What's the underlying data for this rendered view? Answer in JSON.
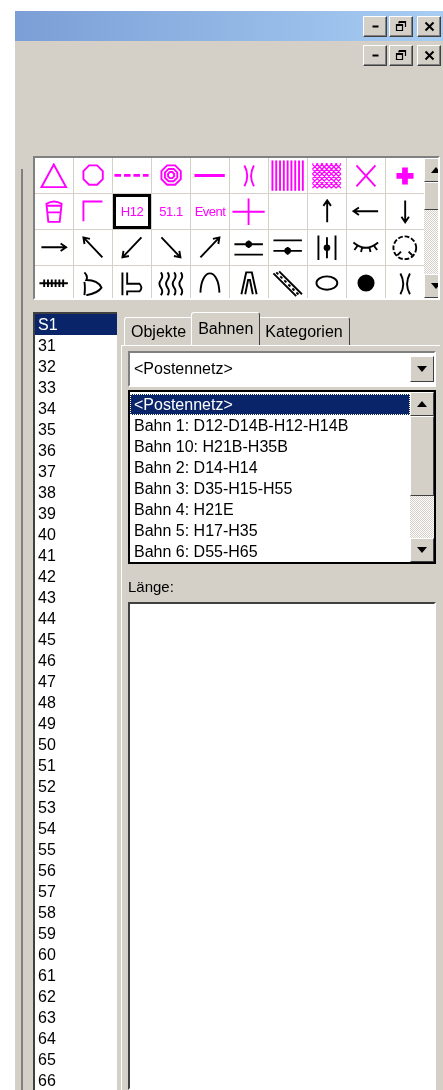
{
  "title_bar": {
    "buttons": [
      {
        "kind": "minimize"
      },
      {
        "kind": "restore"
      },
      {
        "kind": "close"
      }
    ]
  },
  "child_window": {
    "buttons": [
      {
        "kind": "minimize"
      },
      {
        "kind": "restore"
      },
      {
        "kind": "close"
      }
    ]
  },
  "palette": {
    "cells": [
      {
        "kind": "triangle",
        "color": "#ff00ff",
        "selected": false
      },
      {
        "kind": "octagon",
        "color": "#ff00ff",
        "selected": false
      },
      {
        "kind": "dashed-line",
        "color": "#ff00ff",
        "selected": false
      },
      {
        "kind": "concentric",
        "color": "#ff00ff",
        "selected": false
      },
      {
        "kind": "thick-line",
        "color": "#ff00ff",
        "selected": false
      },
      {
        "kind": "bracket",
        "color": "#ff00ff",
        "selected": false
      },
      {
        "kind": "vertical-hatch",
        "color": "#ff00ff",
        "selected": false
      },
      {
        "kind": "crosshatch",
        "color": "#ff00ff",
        "selected": false
      },
      {
        "kind": "x-mark",
        "color": "#ff00ff",
        "selected": false
      },
      {
        "kind": "plus",
        "color": "#ff00ff",
        "selected": false
      },
      {
        "kind": "cup",
        "color": "#ff00ff",
        "selected": false
      },
      {
        "kind": "corner",
        "color": "#ff00ff",
        "selected": false
      },
      {
        "kind": "text",
        "text": "H12",
        "color": "#ff00ff",
        "selected": true
      },
      {
        "kind": "text",
        "text": "51.1",
        "color": "#ff00ff",
        "selected": false
      },
      {
        "kind": "text",
        "text": "Event",
        "color": "#ff00ff",
        "selected": false
      },
      {
        "kind": "plus-line",
        "color": "#ff00ff",
        "selected": false
      },
      {
        "kind": "empty",
        "selected": false
      },
      {
        "kind": "arrow-up",
        "color": "#000000",
        "selected": false
      },
      {
        "kind": "arrow-left",
        "color": "#000000",
        "selected": false
      },
      {
        "kind": "arrow-down",
        "color": "#000000",
        "selected": false
      },
      {
        "kind": "arrow-right",
        "color": "#000000",
        "selected": false
      },
      {
        "kind": "arrow-up-left",
        "color": "#000000",
        "selected": false
      },
      {
        "kind": "arrow-down-left",
        "color": "#000000",
        "selected": false
      },
      {
        "kind": "arrow-down-right",
        "color": "#000000",
        "selected": false
      },
      {
        "kind": "arrow-up-right",
        "color": "#000000",
        "selected": false
      },
      {
        "kind": "lines-dot-top",
        "color": "#000000",
        "selected": false
      },
      {
        "kind": "lines-dot-bottom",
        "color": "#000000",
        "selected": false
      },
      {
        "kind": "vertical-lines-dot",
        "color": "#000000",
        "selected": false
      },
      {
        "kind": "eyelash",
        "color": "#000000",
        "selected": false
      },
      {
        "kind": "gauge",
        "color": "#000000",
        "selected": false
      },
      {
        "kind": "tick-line",
        "color": "#000000",
        "selected": false
      },
      {
        "kind": "curve",
        "color": "#000000",
        "selected": false
      },
      {
        "kind": "step-curve",
        "color": "#000000",
        "selected": false
      },
      {
        "kind": "wavy-lines",
        "color": "#000000",
        "selected": false
      },
      {
        "kind": "arch",
        "color": "#000000",
        "selected": false
      },
      {
        "kind": "narrow-arch",
        "color": "#000000",
        "selected": false
      },
      {
        "kind": "diagonal-lines",
        "color": "#000000",
        "selected": false
      },
      {
        "kind": "ellipse",
        "color": "#000000",
        "selected": false
      },
      {
        "kind": "dot",
        "color": "#000000",
        "selected": false
      },
      {
        "kind": "bracket",
        "color": "#000000",
        "selected": false
      }
    ]
  },
  "layer_list": {
    "items": [
      {
        "label": "S1",
        "selected": true
      },
      {
        "label": "31",
        "selected": false
      },
      {
        "label": "32",
        "selected": false
      },
      {
        "label": "33",
        "selected": false
      },
      {
        "label": "34",
        "selected": false
      },
      {
        "label": "35",
        "selected": false
      },
      {
        "label": "36",
        "selected": false
      },
      {
        "label": "37",
        "selected": false
      },
      {
        "label": "38",
        "selected": false
      },
      {
        "label": "39",
        "selected": false
      },
      {
        "label": "40",
        "selected": false
      },
      {
        "label": "41",
        "selected": false
      },
      {
        "label": "42",
        "selected": false
      },
      {
        "label": "43",
        "selected": false
      },
      {
        "label": "44",
        "selected": false
      },
      {
        "label": "45",
        "selected": false
      },
      {
        "label": "46",
        "selected": false
      },
      {
        "label": "47",
        "selected": false
      },
      {
        "label": "48",
        "selected": false
      },
      {
        "label": "49",
        "selected": false
      },
      {
        "label": "50",
        "selected": false
      },
      {
        "label": "51",
        "selected": false
      },
      {
        "label": "52",
        "selected": false
      },
      {
        "label": "53",
        "selected": false
      },
      {
        "label": "54",
        "selected": false
      },
      {
        "label": "55",
        "selected": false
      },
      {
        "label": "56",
        "selected": false
      },
      {
        "label": "57",
        "selected": false
      },
      {
        "label": "58",
        "selected": false
      },
      {
        "label": "59",
        "selected": false
      },
      {
        "label": "60",
        "selected": false
      },
      {
        "label": "61",
        "selected": false
      },
      {
        "label": "62",
        "selected": false
      },
      {
        "label": "63",
        "selected": false
      },
      {
        "label": "64",
        "selected": false
      },
      {
        "label": "65",
        "selected": false
      },
      {
        "label": "66",
        "selected": false
      }
    ]
  },
  "tabs": [
    {
      "label": "Objekte",
      "selected": false
    },
    {
      "label": "Bahnen",
      "selected": true
    },
    {
      "label": "Kategorien",
      "selected": false
    }
  ],
  "course_dropdown": {
    "value": "<Postennetz>"
  },
  "course_list": {
    "items": [
      {
        "label": "<Postennetz>",
        "selected": true
      },
      {
        "label": "Bahn 1: D12-D14B-H12-H14B",
        "selected": false
      },
      {
        "label": "Bahn 10: H21B-H35B",
        "selected": false
      },
      {
        "label": "Bahn 2: D14-H14",
        "selected": false
      },
      {
        "label": "Bahn 3: D35-H15-H55",
        "selected": false
      },
      {
        "label": "Bahn 4: H21E",
        "selected": false
      },
      {
        "label": "Bahn 5: H17-H35",
        "selected": false
      },
      {
        "label": "Bahn 6: D55-H65",
        "selected": false
      }
    ]
  },
  "length": {
    "label": "Länge:"
  }
}
